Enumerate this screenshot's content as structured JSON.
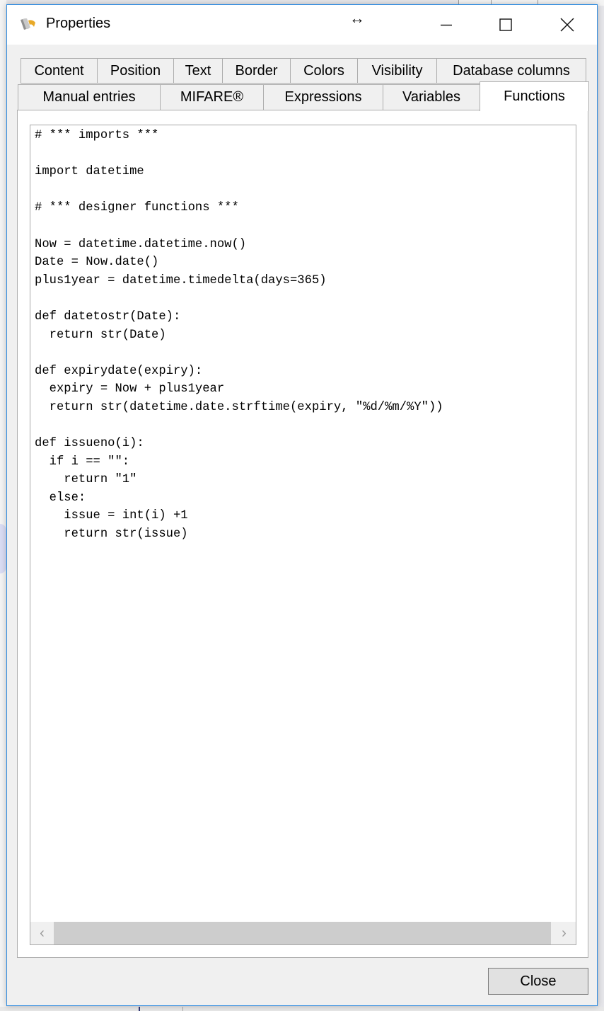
{
  "window": {
    "title": "Properties",
    "app_icon": "app-icon",
    "resize_glyph": "↔",
    "controls": {
      "minimize_icon": "minimize-icon",
      "maximize_icon": "maximize-icon",
      "close_icon": "close-icon"
    }
  },
  "tabs": {
    "row1": [
      {
        "label": "Content"
      },
      {
        "label": "Position"
      },
      {
        "label": "Text"
      },
      {
        "label": "Border"
      },
      {
        "label": "Colors"
      },
      {
        "label": "Visibility"
      },
      {
        "label": "Database columns"
      }
    ],
    "row2": [
      {
        "label": "Manual entries"
      },
      {
        "label": "MIFARE®"
      },
      {
        "label": "Expressions"
      },
      {
        "label": "Variables"
      },
      {
        "label": "Functions",
        "selected": true
      }
    ],
    "selected": "Functions"
  },
  "editor": {
    "lines": [
      "# *** imports ***",
      "",
      "import datetime",
      "",
      "# *** designer functions ***",
      "",
      "Now = datetime.datetime.now()",
      "Date = Now.date()",
      "plus1year = datetime.timedelta(days=365)",
      "",
      "def datetostr(Date):",
      "  return str(Date)",
      "",
      "def expirydate(expiry):",
      "  expiry = Now + plus1year",
      "  return str(datetime.date.strftime(expiry, \"%d/%m/%Y\"))",
      "",
      "def issueno(i):",
      "  if i == \"\":",
      "    return \"1\"",
      "  else:",
      "    issue = int(i) +1",
      "    return str(issue)"
    ],
    "scroll_left_icon": "‹",
    "scroll_right_icon": "›"
  },
  "footer": {
    "close_label": "Close"
  }
}
